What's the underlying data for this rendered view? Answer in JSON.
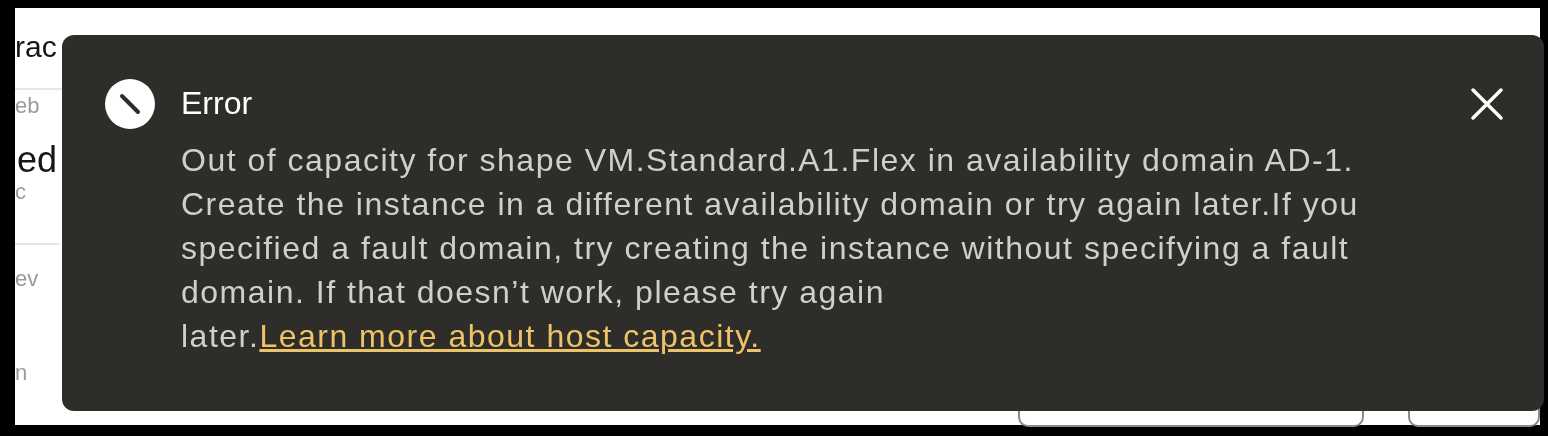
{
  "page": {
    "heading_fragment": "rac",
    "row_fragment": "ed",
    "faint_fragments": [
      "eb",
      "c",
      "ev",
      "n"
    ]
  },
  "toast": {
    "kind": "error",
    "title": "Error",
    "message": "Out of capacity for shape VM.Standard.A1.Flex in availability domain AD-1. Create the instance in a different availability domain or try again later.If you specified a fault domain, try creating the instance without specifying a fault domain. If that doesn’t work, please try again later.",
    "link": "Learn more about host capacity."
  }
}
